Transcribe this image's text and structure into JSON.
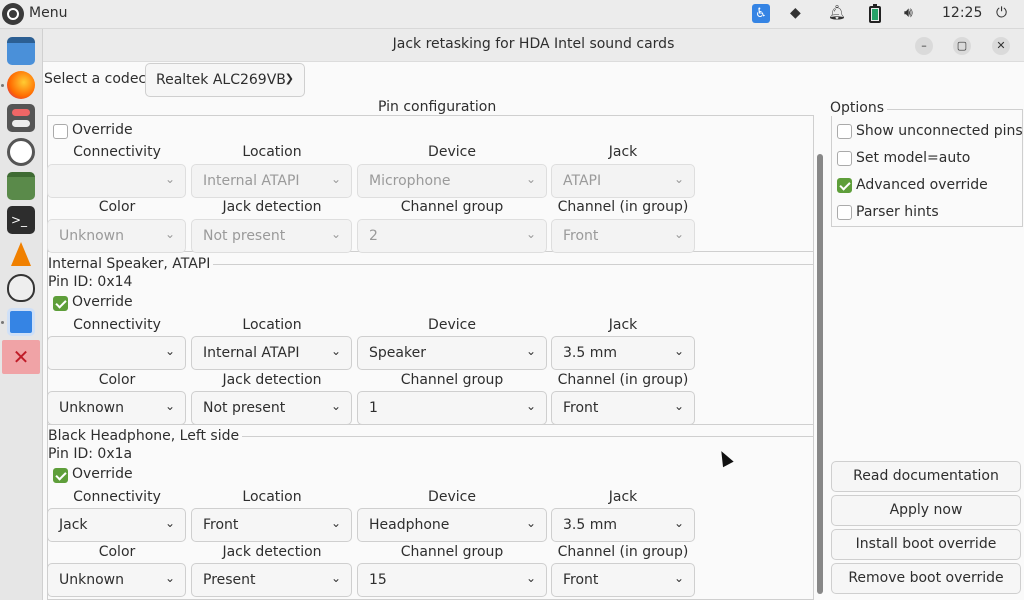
{
  "top_panel": {
    "menu_label": "Menu",
    "clock": "12:25",
    "icons": [
      "accessibility-icon",
      "wifi-icon",
      "bell-icon",
      "battery-icon",
      "volume-icon",
      "power-icon"
    ]
  },
  "dock": {
    "apps": [
      "desktop",
      "firefox",
      "settings",
      "clock",
      "files",
      "terminal",
      "vlc",
      "alien-app",
      "text-editor",
      "jack-retask"
    ]
  },
  "window": {
    "title": "Jack retasking for HDA Intel sound cards",
    "controls": {
      "minimize": "–",
      "maximize": "▢",
      "close": "✕"
    }
  },
  "codec": {
    "label": "Select a codec:",
    "value": "Realtek ALC269VB"
  },
  "pin_frame": {
    "title": "Pin configuration",
    "column_labels": {
      "connectivity": "Connectivity",
      "location": "Location",
      "device": "Device",
      "jack": "Jack",
      "color": "Color",
      "jack_detection": "Jack detection",
      "channel_group": "Channel group",
      "channel_in_group": "Channel (in group)"
    },
    "override_label": "Override",
    "groups": [
      {
        "name": "",
        "pin_id": "",
        "override": false,
        "connectivity": "",
        "location": "Internal ATAPI",
        "device": "Microphone",
        "jack": "ATAPI",
        "color": "Unknown",
        "jack_detection": "Not present",
        "channel_group": "2",
        "channel_in_group": "Front"
      },
      {
        "name": "Internal Speaker, ATAPI",
        "pin_id": "Pin ID: 0x14",
        "override": true,
        "connectivity": "",
        "location": "Internal ATAPI",
        "device": "Speaker",
        "jack": "3.5 mm",
        "color": "Unknown",
        "jack_detection": "Not present",
        "channel_group": "1",
        "channel_in_group": "Front"
      },
      {
        "name": "Black Headphone, Left side",
        "pin_id": "Pin ID: 0x1a",
        "override": true,
        "connectivity": "Jack",
        "location": "Front",
        "device": "Headphone",
        "jack": "3.5 mm",
        "color": "Unknown",
        "jack_detection": "Present",
        "channel_group": "15",
        "channel_in_group": "Front"
      }
    ]
  },
  "options": {
    "title": "Options",
    "items": [
      {
        "label": "Show unconnected pins",
        "checked": false
      },
      {
        "label": "Set model=auto",
        "checked": false
      },
      {
        "label": "Advanced override",
        "checked": true
      },
      {
        "label": "Parser hints",
        "checked": false
      }
    ]
  },
  "actions": {
    "read_docs": "Read documentation",
    "apply_now": "Apply now",
    "install_boot": "Install boot override",
    "remove_boot": "Remove boot override"
  }
}
